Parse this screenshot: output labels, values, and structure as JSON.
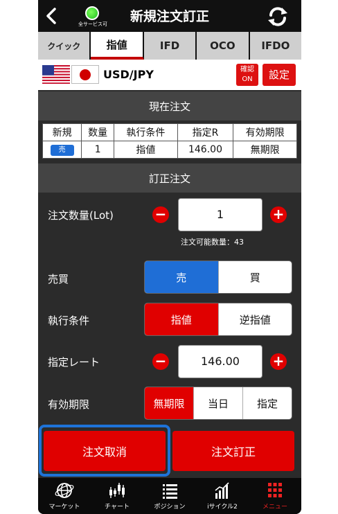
{
  "header": {
    "title": "新規注文訂正",
    "status_label": "全サービス可"
  },
  "tabs": [
    {
      "label": "クイック",
      "active": false
    },
    {
      "label": "指値",
      "active": true
    },
    {
      "label": "IFD",
      "active": false
    },
    {
      "label": "OCO",
      "active": false
    },
    {
      "label": "IFDO",
      "active": false
    }
  ],
  "pair": {
    "name": "USD/JPY",
    "confirm_label_line1": "確認",
    "confirm_label_line2": "ON",
    "settings_label": "設定"
  },
  "current_order": {
    "section_title": "現在注文",
    "headers": [
      "新規",
      "数量",
      "執行条件",
      "指定R",
      "有効期限"
    ],
    "row": {
      "side": "売",
      "quantity": "1",
      "condition": "指値",
      "rate": "146.00",
      "expiry": "無期限"
    }
  },
  "amend_order": {
    "section_title": "訂正注文",
    "quantity_label": "注文数量(Lot)",
    "quantity_value": "1",
    "available_hint": "注文可能数量：43",
    "side_label": "売買",
    "side_options": [
      "売",
      "買"
    ],
    "side_selected": "売",
    "condition_label": "執行条件",
    "condition_options": [
      "指値",
      "逆指値"
    ],
    "condition_selected": "指値",
    "rate_label": "指定レート",
    "rate_value": "146.00",
    "expiry_label": "有効期限",
    "expiry_options": [
      "無期限",
      "当日",
      "指定"
    ],
    "expiry_selected": "無期限"
  },
  "actions": {
    "cancel_label": "注文取消",
    "amend_label": "注文訂正"
  },
  "nav": [
    {
      "label": "マーケット",
      "icon": "globe-icon"
    },
    {
      "label": "チャート",
      "icon": "candlestick-icon"
    },
    {
      "label": "ポジション",
      "icon": "list-icon"
    },
    {
      "label": "iサイクル2",
      "icon": "bar-chart-icon"
    },
    {
      "label": "メニュー",
      "icon": "grid-menu-icon",
      "active": true
    }
  ],
  "colors": {
    "accent_red": "#e00000",
    "accent_blue": "#1f6ed6",
    "focus_outline": "#1e73d8"
  }
}
